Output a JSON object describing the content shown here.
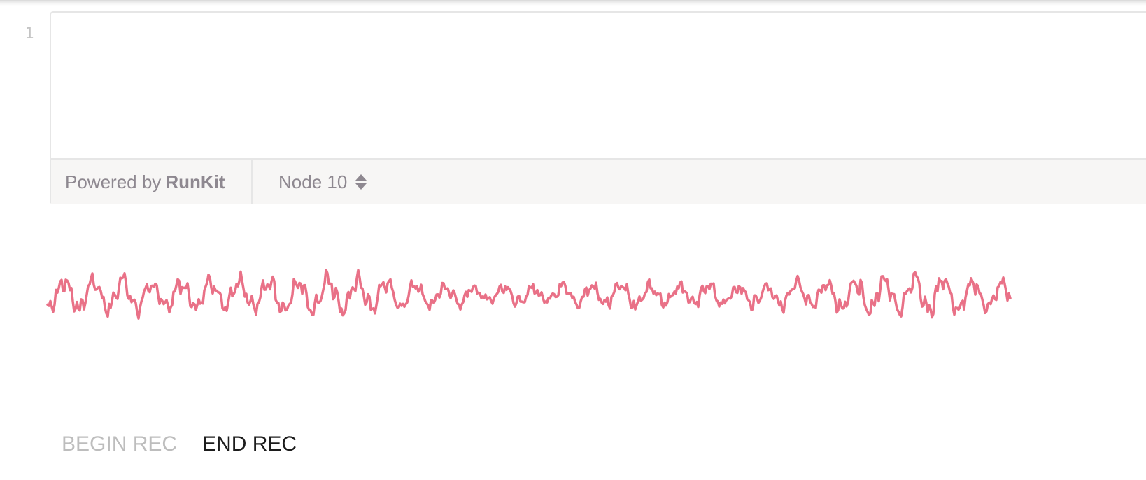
{
  "editor": {
    "line_number": "1",
    "code": ""
  },
  "footer": {
    "powered_by_prefix": "Powered by",
    "powered_by_brand": "RunKit",
    "runtime_label": "Node 10",
    "runtime_icon": "sort-icon"
  },
  "waveform": {
    "color": "#e97187"
  },
  "controls": {
    "begin_rec_label": "BEGIN REC",
    "end_rec_label": "END REC"
  },
  "colors": {
    "footer_text": "#8e8890",
    "disabled_text": "#bdbdbd",
    "active_text": "#1c1c1c"
  }
}
